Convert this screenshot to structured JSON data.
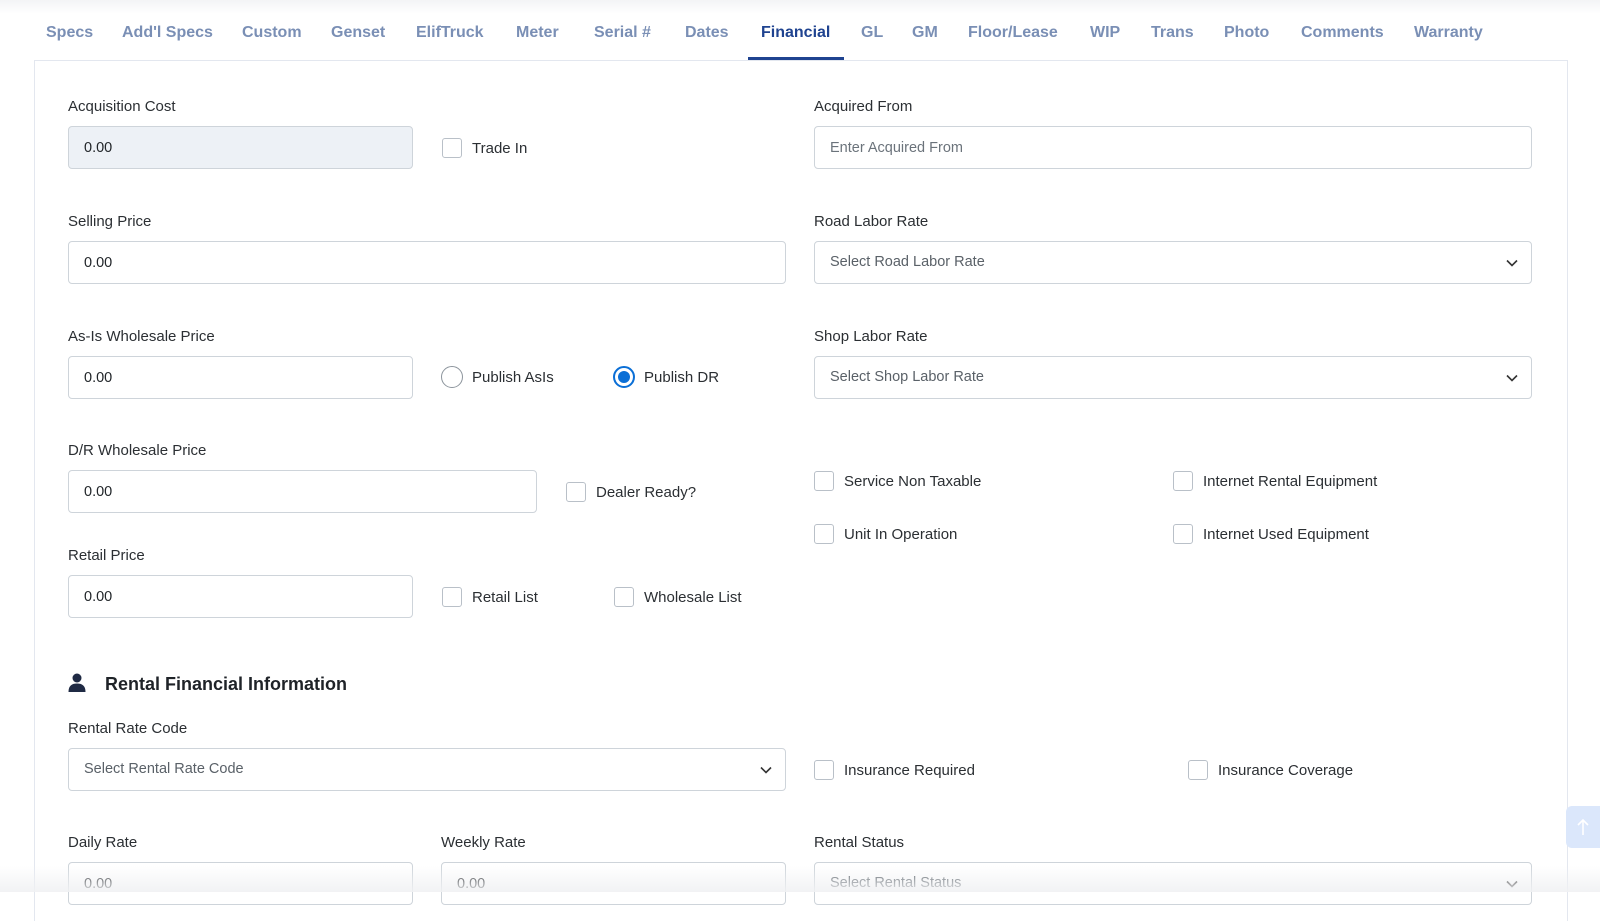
{
  "tabs": [
    {
      "label": "Specs"
    },
    {
      "label": "Add'l Specs"
    },
    {
      "label": "Custom"
    },
    {
      "label": "Genset"
    },
    {
      "label": "ElifTruck"
    },
    {
      "label": "Meter"
    },
    {
      "label": "Serial #"
    },
    {
      "label": "Dates"
    },
    {
      "label": "Financial"
    },
    {
      "label": "GL"
    },
    {
      "label": "GM"
    },
    {
      "label": "Floor/Lease"
    },
    {
      "label": "WIP"
    },
    {
      "label": "Trans"
    },
    {
      "label": "Photo"
    },
    {
      "label": "Comments"
    },
    {
      "label": "Warranty"
    }
  ],
  "active_tab": "Financial",
  "colors": {
    "accent": "#1f4390",
    "tab_inactive": "#7a8fb5",
    "radio_selected": "#0b6fd6"
  },
  "financial": {
    "acquisition_cost": {
      "label": "Acquisition Cost",
      "value": "0.00"
    },
    "trade_in": {
      "label": "Trade In",
      "checked": false
    },
    "acquired_from": {
      "label": "Acquired From",
      "placeholder": "Enter Acquired From"
    },
    "selling_price": {
      "label": "Selling Price",
      "value": "0.00"
    },
    "road_labor_rate": {
      "label": "Road Labor Rate",
      "placeholder": "Select Road Labor Rate"
    },
    "as_is_wholesale_price": {
      "label": "As-Is Wholesale Price",
      "value": "0.00"
    },
    "publish_asis": {
      "label": "Publish AsIs",
      "checked": false
    },
    "publish_dr": {
      "label": "Publish DR",
      "checked": true
    },
    "shop_labor_rate": {
      "label": "Shop Labor Rate",
      "placeholder": "Select Shop Labor Rate"
    },
    "dr_wholesale_price": {
      "label": "D/R Wholesale Price",
      "value": "0.00"
    },
    "dealer_ready": {
      "label": "Dealer Ready?",
      "checked": false
    },
    "service_non_taxable": {
      "label": "Service Non Taxable",
      "checked": false
    },
    "internet_rental_equipment": {
      "label": "Internet Rental Equipment",
      "checked": false
    },
    "unit_in_operation": {
      "label": "Unit In Operation",
      "checked": false
    },
    "internet_used_equipment": {
      "label": "Internet Used Equipment",
      "checked": false
    },
    "retail_price": {
      "label": "Retail Price",
      "value": "0.00"
    },
    "retail_list": {
      "label": "Retail List",
      "checked": false
    },
    "wholesale_list": {
      "label": "Wholesale List",
      "checked": false
    }
  },
  "rental": {
    "section_title": "Rental Financial Information",
    "section_icon": "user-icon",
    "rental_rate_code": {
      "label": "Rental Rate Code",
      "placeholder": "Select Rental Rate Code"
    },
    "insurance_required": {
      "label": "Insurance Required",
      "checked": false
    },
    "insurance_coverage": {
      "label": "Insurance Coverage",
      "checked": false
    },
    "daily_rate": {
      "label": "Daily Rate",
      "value": "0.00"
    },
    "weekly_rate": {
      "label": "Weekly Rate",
      "value": "0.00"
    },
    "rental_status": {
      "label": "Rental Status",
      "placeholder": "Select Rental Status"
    }
  },
  "scroll_top_icon": "arrow-up-icon"
}
